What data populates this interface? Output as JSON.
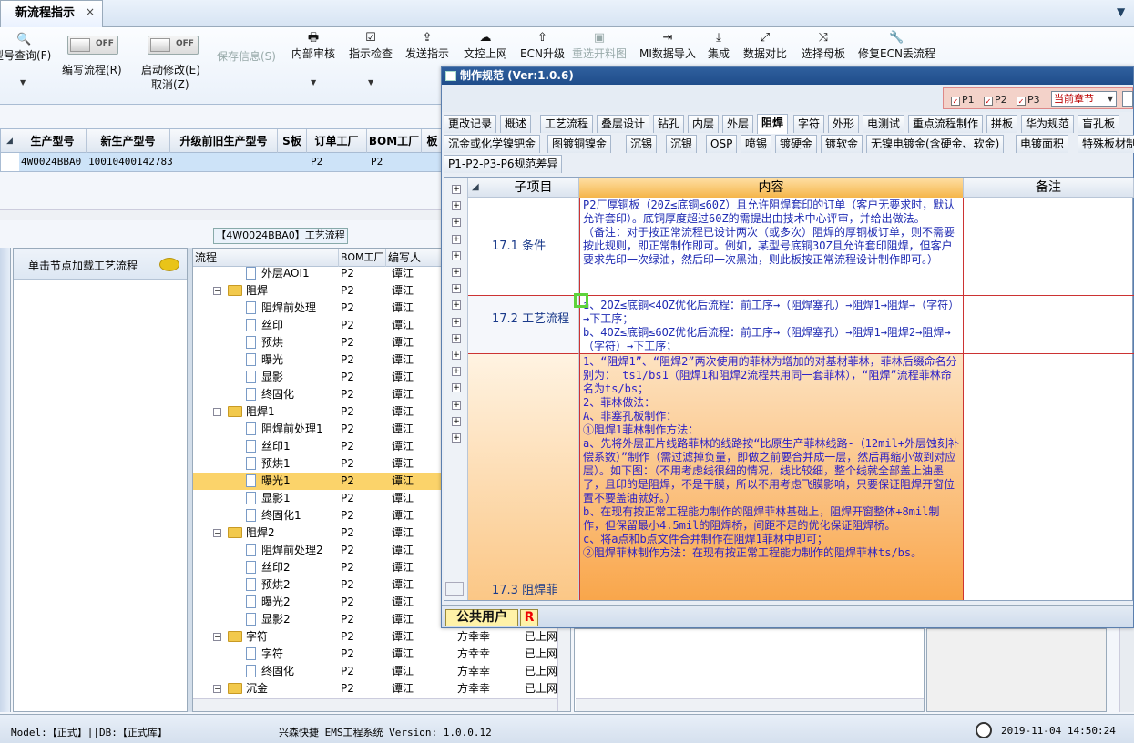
{
  "tab": {
    "title": "新流程指示",
    "close": "×"
  },
  "toolbar": {
    "items": [
      {
        "label": "型号查询(F)",
        "icon": "🔍"
      },
      {
        "label": "编写流程(R)"
      },
      {
        "label": "启动修改(E)"
      },
      {
        "label": "取消(Z)"
      },
      {
        "label": "保存信息(S)",
        "icon": "💾"
      },
      {
        "label": "内部审核",
        "icon": "🖶"
      },
      {
        "label": "指示检查",
        "icon": "☑"
      },
      {
        "label": "发送指示",
        "icon": "⇪"
      },
      {
        "label": "文控上网",
        "icon": "☁"
      },
      {
        "label": "ECN升级",
        "icon": "⇧"
      },
      {
        "label": "重选开料图",
        "icon": "▣"
      },
      {
        "label": "MI数据导入",
        "icon": "⇥"
      },
      {
        "label": "集成",
        "icon": "⤓"
      },
      {
        "label": "数据对比",
        "icon": "⤢"
      },
      {
        "label": "选择母板",
        "icon": "⤨"
      },
      {
        "label": "修复ECN丢流程",
        "icon": "🔧"
      }
    ],
    "toggle_off": "OFF"
  },
  "grid": {
    "headers": [
      "生产型号",
      "新生产型号",
      "升级前旧生产型号",
      "S板",
      "订单工厂",
      "BOM工厂",
      "板"
    ],
    "row": [
      "4W0024BBA0",
      "10010400142783",
      "",
      "",
      "P2",
      "P2",
      ""
    ]
  },
  "flow_caption": "【4W0024BBA0】工艺流程",
  "left_panel": {
    "hint": "单击节点加载工艺流程",
    "side_label": "工艺流程"
  },
  "tree": {
    "headers": [
      "流程",
      "BOM工厂",
      "编写人"
    ],
    "extra_headers": [
      "",
      ""
    ],
    "rows": [
      {
        "indent": 1,
        "type": "doc",
        "name": "外层AOI1",
        "bom": "P2",
        "writer": "谭江"
      },
      {
        "indent": 0,
        "type": "folder",
        "name": "阻焊",
        "bom": "P2",
        "writer": "谭江"
      },
      {
        "indent": 1,
        "type": "doc",
        "name": "阻焊前处理",
        "bom": "P2",
        "writer": "谭江"
      },
      {
        "indent": 1,
        "type": "doc",
        "name": "丝印",
        "bom": "P2",
        "writer": "谭江"
      },
      {
        "indent": 1,
        "type": "doc",
        "name": "预烘",
        "bom": "P2",
        "writer": "谭江"
      },
      {
        "indent": 1,
        "type": "doc",
        "name": "曝光",
        "bom": "P2",
        "writer": "谭江"
      },
      {
        "indent": 1,
        "type": "doc",
        "name": "显影",
        "bom": "P2",
        "writer": "谭江"
      },
      {
        "indent": 1,
        "type": "doc",
        "name": "终固化",
        "bom": "P2",
        "writer": "谭江"
      },
      {
        "indent": 0,
        "type": "folder",
        "name": "阻焊1",
        "bom": "P2",
        "writer": "谭江"
      },
      {
        "indent": 1,
        "type": "doc",
        "name": "阻焊前处理1",
        "bom": "P2",
        "writer": "谭江"
      },
      {
        "indent": 1,
        "type": "doc",
        "name": "丝印1",
        "bom": "P2",
        "writer": "谭江"
      },
      {
        "indent": 1,
        "type": "doc",
        "name": "预烘1",
        "bom": "P2",
        "writer": "谭江"
      },
      {
        "indent": 1,
        "type": "doc",
        "name": "曝光1",
        "bom": "P2",
        "writer": "谭江",
        "selected": true
      },
      {
        "indent": 1,
        "type": "doc",
        "name": "显影1",
        "bom": "P2",
        "writer": "谭江"
      },
      {
        "indent": 1,
        "type": "doc",
        "name": "终固化1",
        "bom": "P2",
        "writer": "谭江"
      },
      {
        "indent": 0,
        "type": "folder",
        "name": "阻焊2",
        "bom": "P2",
        "writer": "谭江"
      },
      {
        "indent": 1,
        "type": "doc",
        "name": "阻焊前处理2",
        "bom": "P2",
        "writer": "谭江"
      },
      {
        "indent": 1,
        "type": "doc",
        "name": "丝印2",
        "bom": "P2",
        "writer": "谭江"
      },
      {
        "indent": 1,
        "type": "doc",
        "name": "预烘2",
        "bom": "P2",
        "writer": "谭江"
      },
      {
        "indent": 1,
        "type": "doc",
        "name": "曝光2",
        "bom": "P2",
        "writer": "谭江"
      },
      {
        "indent": 1,
        "type": "doc",
        "name": "显影2",
        "bom": "P2",
        "writer": "谭江"
      },
      {
        "indent": 0,
        "type": "folder",
        "name": "字符",
        "bom": "P2",
        "writer": "谭江",
        "c4": "方幸幸",
        "c5": "已上网"
      },
      {
        "indent": 1,
        "type": "doc",
        "name": "字符",
        "bom": "P2",
        "writer": "谭江",
        "c4": "方幸幸",
        "c5": "已上网"
      },
      {
        "indent": 1,
        "type": "doc",
        "name": "终固化",
        "bom": "P2",
        "writer": "谭江",
        "c4": "方幸幸",
        "c5": "已上网"
      },
      {
        "indent": 0,
        "type": "folder",
        "name": "沉金",
        "bom": "P2",
        "writer": "谭江",
        "c4": "方幸幸",
        "c5": "已上网"
      }
    ]
  },
  "dialog": {
    "title": "制作规范 (Ver:1.0.6)",
    "checks": [
      "P1",
      "P2",
      "P3"
    ],
    "chapter_select": "当前章节",
    "tabs_row1": [
      "更改记录",
      "概述",
      "工艺流程",
      "叠层设计",
      "钻孔",
      "内层",
      "外层",
      "阻焊",
      "字符",
      "外形",
      "电测试",
      "重点流程制作",
      "拼板",
      "华为规范",
      "盲孔板"
    ],
    "tabs_row2": [
      "沉金或化学镍钯金",
      "图镀铜镍金",
      "沉锡",
      "沉银",
      "OSP",
      "喷锡",
      "镀硬金",
      "镀软金",
      "无镍电镀金(含硬金、软金)",
      "电镀面积",
      "特殊板材制作"
    ],
    "tabs_row3": [
      "P1-P2-P3-P6规范差异"
    ],
    "active_tab": "阻焊",
    "table_headers": [
      "子项目",
      "内容",
      "备注"
    ],
    "rows": [
      {
        "subject": "17.1 条件",
        "content": "P2厂厚铜板（20Z≤底铜≤60Z）且允许阻焊套印的订单（客户无要求时，默认允许套印）。底铜厚度超过60Z的需提出由技术中心评审，并给出做法。\n（备注：对于按正常流程已设计两次（或多次）阻焊的厚铜板订单，则不需要按此规则，即正常制作即可。例如，某型号底铜3OZ且允许套印阻焊，但客户要求先印一次绿油，然后印一次黑油，则此板按正常流程设计制作即可。）"
      },
      {
        "subject": "17.2 工艺流程",
        "content": "a、2OZ≤底铜<4OZ优化后流程：前工序→（阻焊塞孔）→阻焊1→阻焊→（字符）→下工序；\nb、4OZ≤底铜≤6OZ优化后流程：前工序→（阻焊塞孔）→阻焊1→阻焊2→阻焊→（字符）→下工序；"
      },
      {
        "subject": "17.3 阻焊菲",
        "content": "1、“阻焊1”、“阻焊2”两次使用的菲林为增加的对基材菲林，菲林后缀命名分别为： ts1/bs1（阻焊1和阻焊2流程共用同一套菲林），“阻焊”流程菲林命名为ts/bs；\n2、菲林做法：\nA、非塞孔板制作：\n①阻焊1菲林制作方法：\na、先将外层正片线路菲林的线路按“比原生产菲林线路-（12mil+外层蚀刻补偿系数）”制作（需过滤掉负量，即做之前要合并成一层，然后再缩小做到对应层）。如下图：（不用考虑线很细的情况，线比较细，整个线就全部盖上油墨了，且印的是阻焊，不是干膜，所以不用考虑飞膜影响，只要保证阻焊开窗位置不要盖油就好。）\nb、在现有按正常工程能力制作的阻焊菲林基础上，阻焊开窗整体+8mil制作，但保留最小4.5mil的阻焊桥，间距不足的优化保证阻焊桥。\nc、将a点和b点文件合并制作在阻焊1菲林中即可；\n②阻焊菲林制作方法：在现有按正常工程能力制作的阻焊菲林ts/bs。"
      }
    ],
    "footer_user": "公共用户",
    "footer_badge": "R"
  },
  "status": {
    "model": "Model:【正式】||DB:【正式库】",
    "app": "兴森快捷 EMS工程系统 Version: 1.0.0.12",
    "time": "2019-11-04 14:50:24"
  },
  "colors": {
    "title_bar": "#1f4d8a",
    "selected_row": "#fbd36a",
    "content_text": "#1f2bb3",
    "highlight": "#5ed33b"
  }
}
